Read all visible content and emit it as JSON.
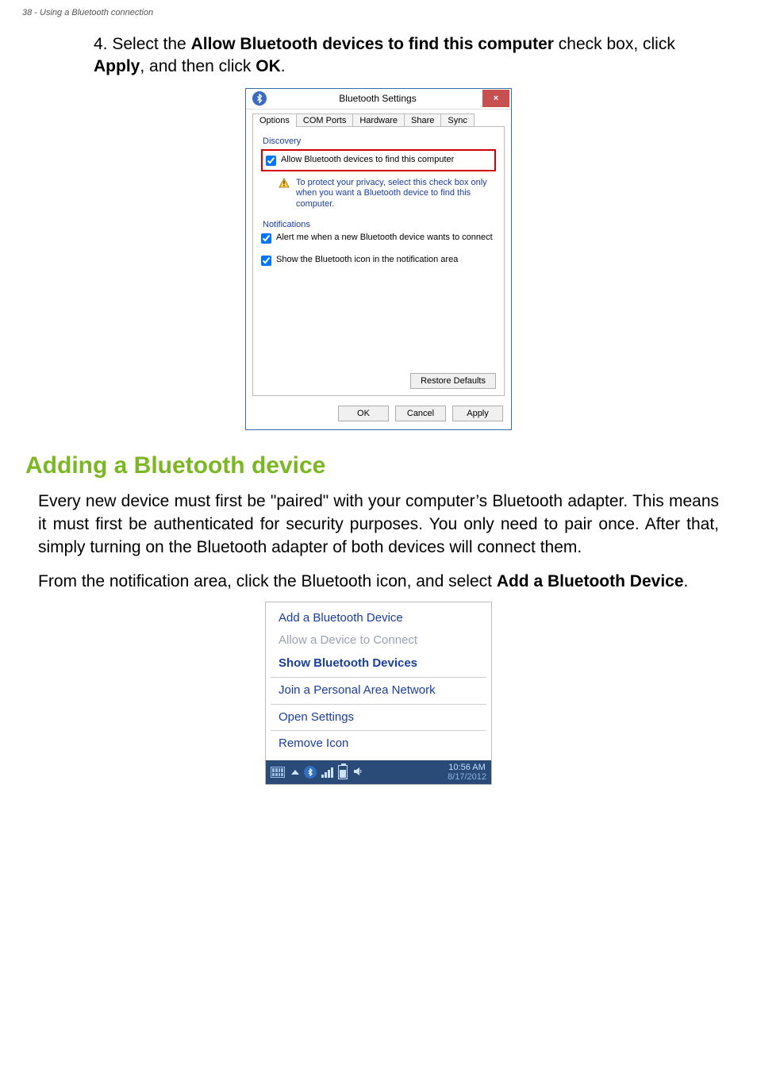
{
  "page_header": "38 - Using a Bluetooth connection",
  "step4": {
    "prefix": "4. Select the ",
    "bold1": "Allow Bluetooth devices to find this computer",
    "mid1": " check box, click ",
    "bold2": "Apply",
    "mid2": ", and then click ",
    "bold3": "OK",
    "suffix": "."
  },
  "dialog": {
    "title": "Bluetooth Settings",
    "close": "×",
    "tabs": [
      "Options",
      "COM Ports",
      "Hardware",
      "Share",
      "Sync"
    ],
    "active_tab_index": 0,
    "discovery_label": "Discovery",
    "allow_find": "Allow Bluetooth devices to find this computer",
    "warn_text": "To protect your privacy, select this check box only when you want a Bluetooth device to find this computer.",
    "notifications_label": "Notifications",
    "alert_connect": "Alert me when a new Bluetooth device wants to connect",
    "show_icon": "Show the Bluetooth icon in the notification area",
    "restore_defaults": "Restore Defaults",
    "ok": "OK",
    "cancel": "Cancel",
    "apply": "Apply"
  },
  "section_title": "Adding a Bluetooth device",
  "para1": "Every new device must first be \"paired\" with your computer’s Bluetooth adapter. This means it must first be authenticated for security purposes. You only need to pair once. After that, simply turning on the Bluetooth adapter of both devices will connect them.",
  "para2_pre": "From the notification area, click the Bluetooth icon, and select ",
  "para2_bold": "Add a Bluetooth Device",
  "para2_post": ".",
  "tray": {
    "items": [
      {
        "label": "Add a Bluetooth Device",
        "style": "normal"
      },
      {
        "label": "Allow a Device to Connect",
        "style": "disabled"
      },
      {
        "label": "Show Bluetooth Devices",
        "style": "bold"
      },
      {
        "label": "Join a Personal Area Network",
        "style": "normal"
      },
      {
        "label": "Open Settings",
        "style": "normal"
      },
      {
        "label": "Remove Icon",
        "style": "normal"
      }
    ],
    "clock_time": "10:56 AM",
    "clock_date": "8/17/2012"
  }
}
